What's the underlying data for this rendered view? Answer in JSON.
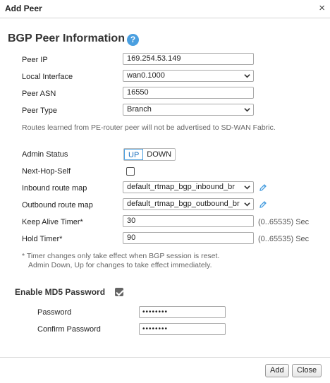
{
  "dialog": {
    "title": "Add Peer",
    "close_glyph": "×"
  },
  "section": {
    "title": "BGP Peer Information",
    "help_glyph": "?"
  },
  "fields": {
    "peer_ip": {
      "label": "Peer IP",
      "value": "169.254.53.149"
    },
    "local_interface": {
      "label": "Local Interface",
      "value": "wan0.1000"
    },
    "peer_asn": {
      "label": "Peer ASN",
      "value": "16550"
    },
    "peer_type": {
      "label": "Peer Type",
      "value": "Branch"
    }
  },
  "routes_note": "Routes learned from PE-router peer will not be advertised to SD-WAN Fabric.",
  "admin_status": {
    "label": "Admin Status",
    "up": "UP",
    "down": "DOWN",
    "selected": "UP"
  },
  "next_hop_self": {
    "label": "Next-Hop-Self",
    "checked": false
  },
  "inbound_route_map": {
    "label": "Inbound route map",
    "value": "default_rtmap_bgp_inbound_br",
    "icon": "pencil-icon"
  },
  "outbound_route_map": {
    "label": "Outbound route map",
    "value": "default_rtmap_bgp_outbound_br",
    "icon": "pencil-icon"
  },
  "keep_alive_timer": {
    "label": "Keep Alive Timer*",
    "value": "30",
    "unit": "(0..65535) Sec"
  },
  "hold_timer": {
    "label": "Hold Timer*",
    "value": "90",
    "unit": "(0..65535) Sec"
  },
  "timer_note": {
    "line1": "* Timer changes only take effect when BGP session is reset.",
    "line2": "Admin Down, Up for changes to take effect immediately."
  },
  "md5": {
    "label": "Enable MD5 Password",
    "checked": true,
    "password_label": "Password",
    "password_value": "••••••••",
    "confirm_label": "Confirm Password",
    "confirm_value": "••••••••"
  },
  "buttons": {
    "add": "Add",
    "close": "Close"
  },
  "colors": {
    "accent": "#4a9fe0",
    "accent_text": "#1a6fbf",
    "checkbox_checked": "#666666"
  }
}
